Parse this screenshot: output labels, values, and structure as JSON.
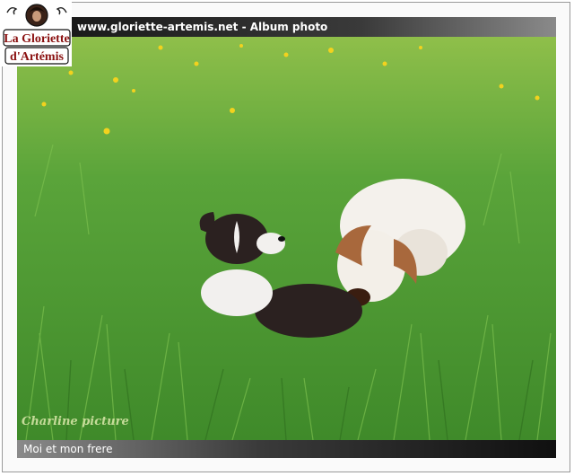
{
  "header": {
    "title": "www.gloriette-artemis.net - Album photo"
  },
  "logo": {
    "line1": "La Gloriette",
    "line2": "d'Artémis"
  },
  "photo": {
    "watermark": "Charline picture"
  },
  "caption": {
    "text": "Moi et mon frere"
  },
  "colors": {
    "grass": "#5aa43a",
    "header_bg": "#2a2a2a",
    "footer_bg": "#3a3a3a",
    "text": "#ffffff"
  }
}
